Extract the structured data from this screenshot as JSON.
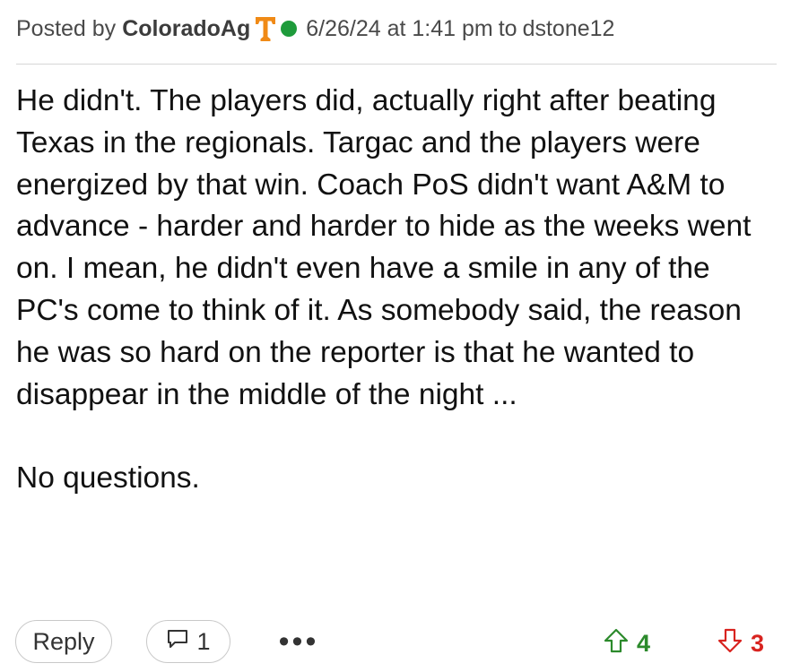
{
  "post": {
    "posted_by_label": "Posted by",
    "author": "ColoradoAg",
    "team_logo_letter": "T",
    "team_logo_color": "#f08a16",
    "online_status_color": "#1e9b3b",
    "timestamp": "6/26/24 at 1:41 pm",
    "reply_to_label": "to",
    "reply_to_user": "dstone12",
    "body_paragraph_1": "He didn't. The players did, actually right after beating Texas in the regionals. Targac and the players were energized by that win. Coach PoS didn't want A&M to advance - harder and harder to hide as the weeks went on. I mean, he didn't even have a smile in any of the PC's come to think of it. As somebody said, the reason he was so hard on the reporter is that he wanted to disappear in the middle of the night ...",
    "body_paragraph_2": "No questions."
  },
  "actions": {
    "reply_label": "Reply",
    "comment_icon": "speech-bubble-icon",
    "comment_count": "1",
    "more_label": "•••",
    "upvote_icon": "up-arrow-icon",
    "upvote_count": "4",
    "upvote_color": "#2c8a2c",
    "downvote_icon": "down-arrow-icon",
    "downvote_count": "3",
    "downvote_color": "#d8231f"
  }
}
